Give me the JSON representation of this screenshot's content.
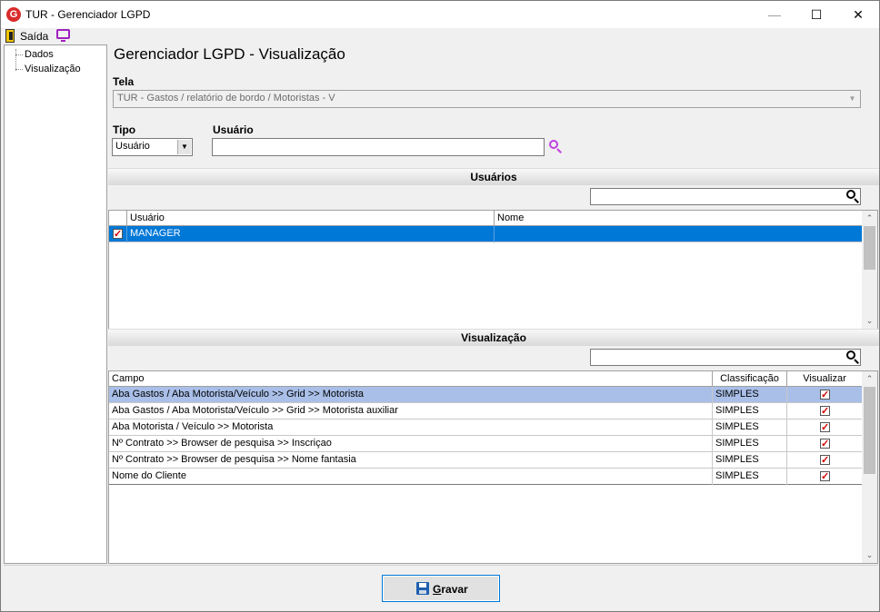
{
  "window": {
    "title": "TUR - Gerenciador LGPD",
    "app_icon_letter": "G",
    "minimize_glyph": "—",
    "maximize_glyph": "☐",
    "close_glyph": "✕"
  },
  "toolbar": {
    "exit_label": "Saída",
    "exit_icon": "door-exit-icon",
    "monitor_icon": "monitor-icon"
  },
  "tree": {
    "items": [
      {
        "label": "Dados"
      },
      {
        "label": "Visualização"
      }
    ]
  },
  "main": {
    "page_title": "Gerenciador LGPD - Visualização",
    "tela_label": "Tela",
    "tela_value": "TUR - Gastos / relatório de bordo / Motoristas - V",
    "tipo_label": "Tipo",
    "tipo_value": "Usuário",
    "usuario_label": "Usuário",
    "usuario_value": ""
  },
  "users_section": {
    "title": "Usuários",
    "search_value": "",
    "columns": [
      "Usuário",
      "Nome"
    ],
    "rows": [
      {
        "checked": true,
        "usuario": "MANAGER",
        "nome": "",
        "selected": true
      }
    ]
  },
  "view_section": {
    "title": "Visualização",
    "search_value": "",
    "columns": [
      "Campo",
      "Classificação",
      "Visualizar"
    ],
    "rows": [
      {
        "campo": "Aba Gastos / Aba  Motorista/Veículo >> Grid >> Motorista",
        "classificacao": "SIMPLES",
        "visualizar": true
      },
      {
        "campo": "Aba Gastos / Aba  Motorista/Veículo >> Grid >> Motorista auxiliar",
        "classificacao": "SIMPLES",
        "visualizar": true
      },
      {
        "campo": "Aba Motorista / Veículo >> Motorista",
        "classificacao": "SIMPLES",
        "visualizar": true
      },
      {
        "campo": "Nº Contrato >> Browser de pesquisa >> Inscriçao",
        "classificacao": "SIMPLES",
        "visualizar": true
      },
      {
        "campo": "Nº Contrato >> Browser de pesquisa >> Nome fantasia",
        "classificacao": "SIMPLES",
        "visualizar": true
      },
      {
        "campo": "Nome do Cliente",
        "classificacao": "SIMPLES",
        "visualizar": true
      }
    ]
  },
  "footer": {
    "save_label_underlined": "G",
    "save_label_rest": "ravar"
  },
  "colors": {
    "selection_user": "#0078d7",
    "selection_view": "#a9bfe8",
    "check_red": "#d00000",
    "accent_purple": "#a020c0"
  }
}
